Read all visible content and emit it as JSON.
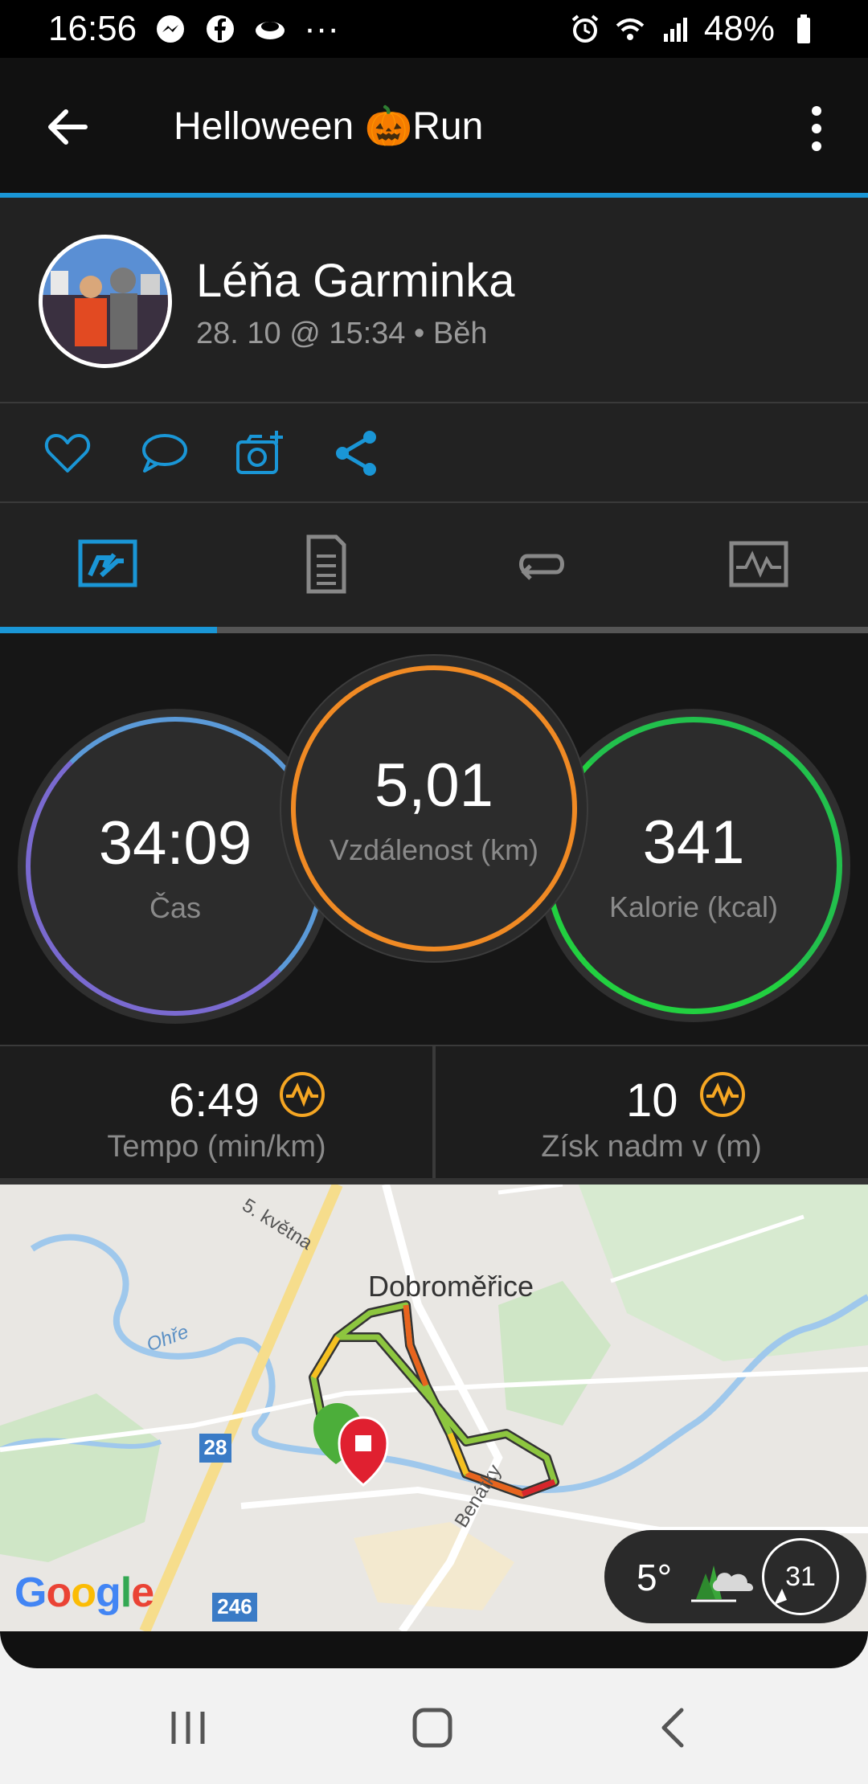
{
  "status_bar": {
    "time": "16:56",
    "more": "···",
    "battery": "48%"
  },
  "app_bar": {
    "title": "Helloween 🎃Run"
  },
  "profile": {
    "name": "Léňa Garminka",
    "meta": "28. 10 @ 15:34 • Běh"
  },
  "stats": {
    "time": {
      "value": "34:09",
      "label": "Čas"
    },
    "distance": {
      "value": "5,01",
      "label": "Vzdálenost (km)"
    },
    "calories": {
      "value": "341",
      "label": "Kalorie (kcal)"
    }
  },
  "metrics": {
    "pace": {
      "value": "6:49",
      "label": "Tempo (min/km)"
    },
    "elevation": {
      "value": "10",
      "label": "Získ nadm v (m)"
    }
  },
  "map": {
    "place": "Dobroměřice",
    "street_1": "5. května",
    "street_2": "Benátky",
    "river": "Ohře",
    "road_1": "28",
    "road_2": "246",
    "google": "Google"
  },
  "weather": {
    "temperature": "5°",
    "wind": "31"
  },
  "colors": {
    "accent": "#1a96d6",
    "time_ring": "#5b9ad8",
    "distance_ring": "#f08a24",
    "calories_ring": "#22c94a",
    "chart_icon": "#f5a623"
  }
}
